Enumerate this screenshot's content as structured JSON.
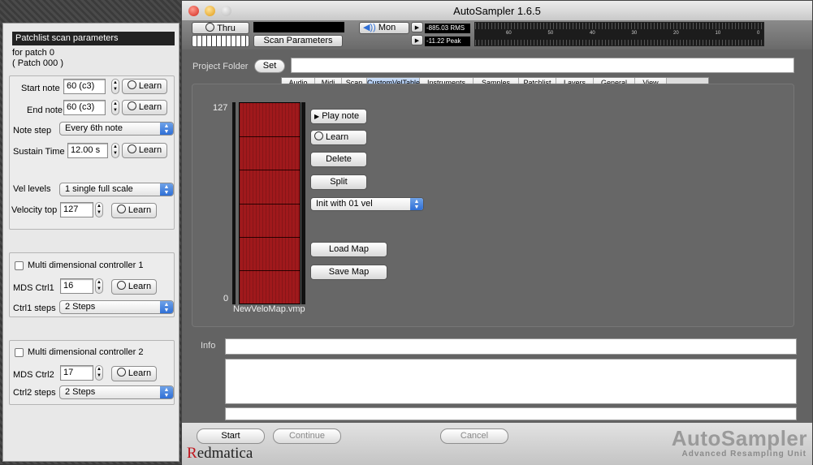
{
  "left_panel": {
    "title": "Patchlist scan parameters",
    "patch_line1": "for patch 0",
    "patch_line2": "( Patch 000 )",
    "start_note_label": "Start note",
    "start_note_value": "60 (c3)",
    "end_note_label": "End note",
    "end_note_value": "60 (c3)",
    "note_step_label": "Note step",
    "note_step_value": "Every 6th note",
    "sustain_label": "Sustain Time",
    "sustain_value": "12.00 s",
    "vel_levels_label": "Vel levels",
    "vel_levels_value": "1 single full scale",
    "velocity_top_label": "Velocity top",
    "velocity_top_value": "127",
    "learn_label": "Learn",
    "mdc1_label": "Multi dimensional controller 1",
    "mds1_label": "MDS Ctrl1",
    "mds1_value": "16",
    "ctrl1_steps_label": "Ctrl1 steps",
    "ctrl1_steps_value": "2 Steps",
    "mdc2_label": "Multi dimensional controller 2",
    "mds2_label": "MDS Ctrl2",
    "mds2_value": "17",
    "ctrl2_steps_label": "Ctrl2 steps",
    "ctrl2_steps_value": "2 Steps"
  },
  "window": {
    "title": "AutoSampler 1.6.5"
  },
  "toolbar": {
    "thru_label": "Thru",
    "scan_params_label": "Scan Parameters",
    "mon_label": "Mon",
    "rms_value": "-885.03 RMS",
    "peak_value": "-11.22 Peak",
    "scale_ticks": [
      "60",
      "50",
      "40",
      "30",
      "20",
      "10",
      "0"
    ]
  },
  "project": {
    "folder_label": "Project Folder",
    "set_label": "Set",
    "folder_value": ""
  },
  "tabs": [
    {
      "label": "Audio",
      "active": false
    },
    {
      "label": "Midi",
      "active": false
    },
    {
      "label": "Scan",
      "active": false
    },
    {
      "label": "CustomVelTable",
      "active": true
    },
    {
      "label": "Instruments",
      "active": false
    },
    {
      "label": "Samples",
      "active": false
    },
    {
      "label": "Patchlist",
      "active": false
    },
    {
      "label": "Layers",
      "active": false
    },
    {
      "label": "General",
      "active": false
    },
    {
      "label": "View",
      "active": false
    }
  ],
  "velocity": {
    "top_label": "127",
    "bottom_label": "0",
    "file_name": "NewVeloMap.vmp",
    "bands": 6,
    "fill_color": "#a0191c"
  },
  "velocity_buttons": {
    "play_note": "Play note",
    "learn": "Learn",
    "delete": "Delete",
    "split": "Split",
    "init_with": "Init with 01 vel",
    "load_map": "Load Map",
    "save_map": "Save Map"
  },
  "info": {
    "label": "Info"
  },
  "bottom": {
    "start": "Start",
    "continue": "Continue",
    "cancel": "Cancel",
    "brand": "Redmatica",
    "brand_first_letter": "R",
    "brand_rest": "edmatica",
    "product": "AutoSampler",
    "product_sub": "Advanced Resampling Unit"
  },
  "colors": {
    "accent_blue": "#2f6fd6",
    "brand_red": "#c0141c"
  }
}
